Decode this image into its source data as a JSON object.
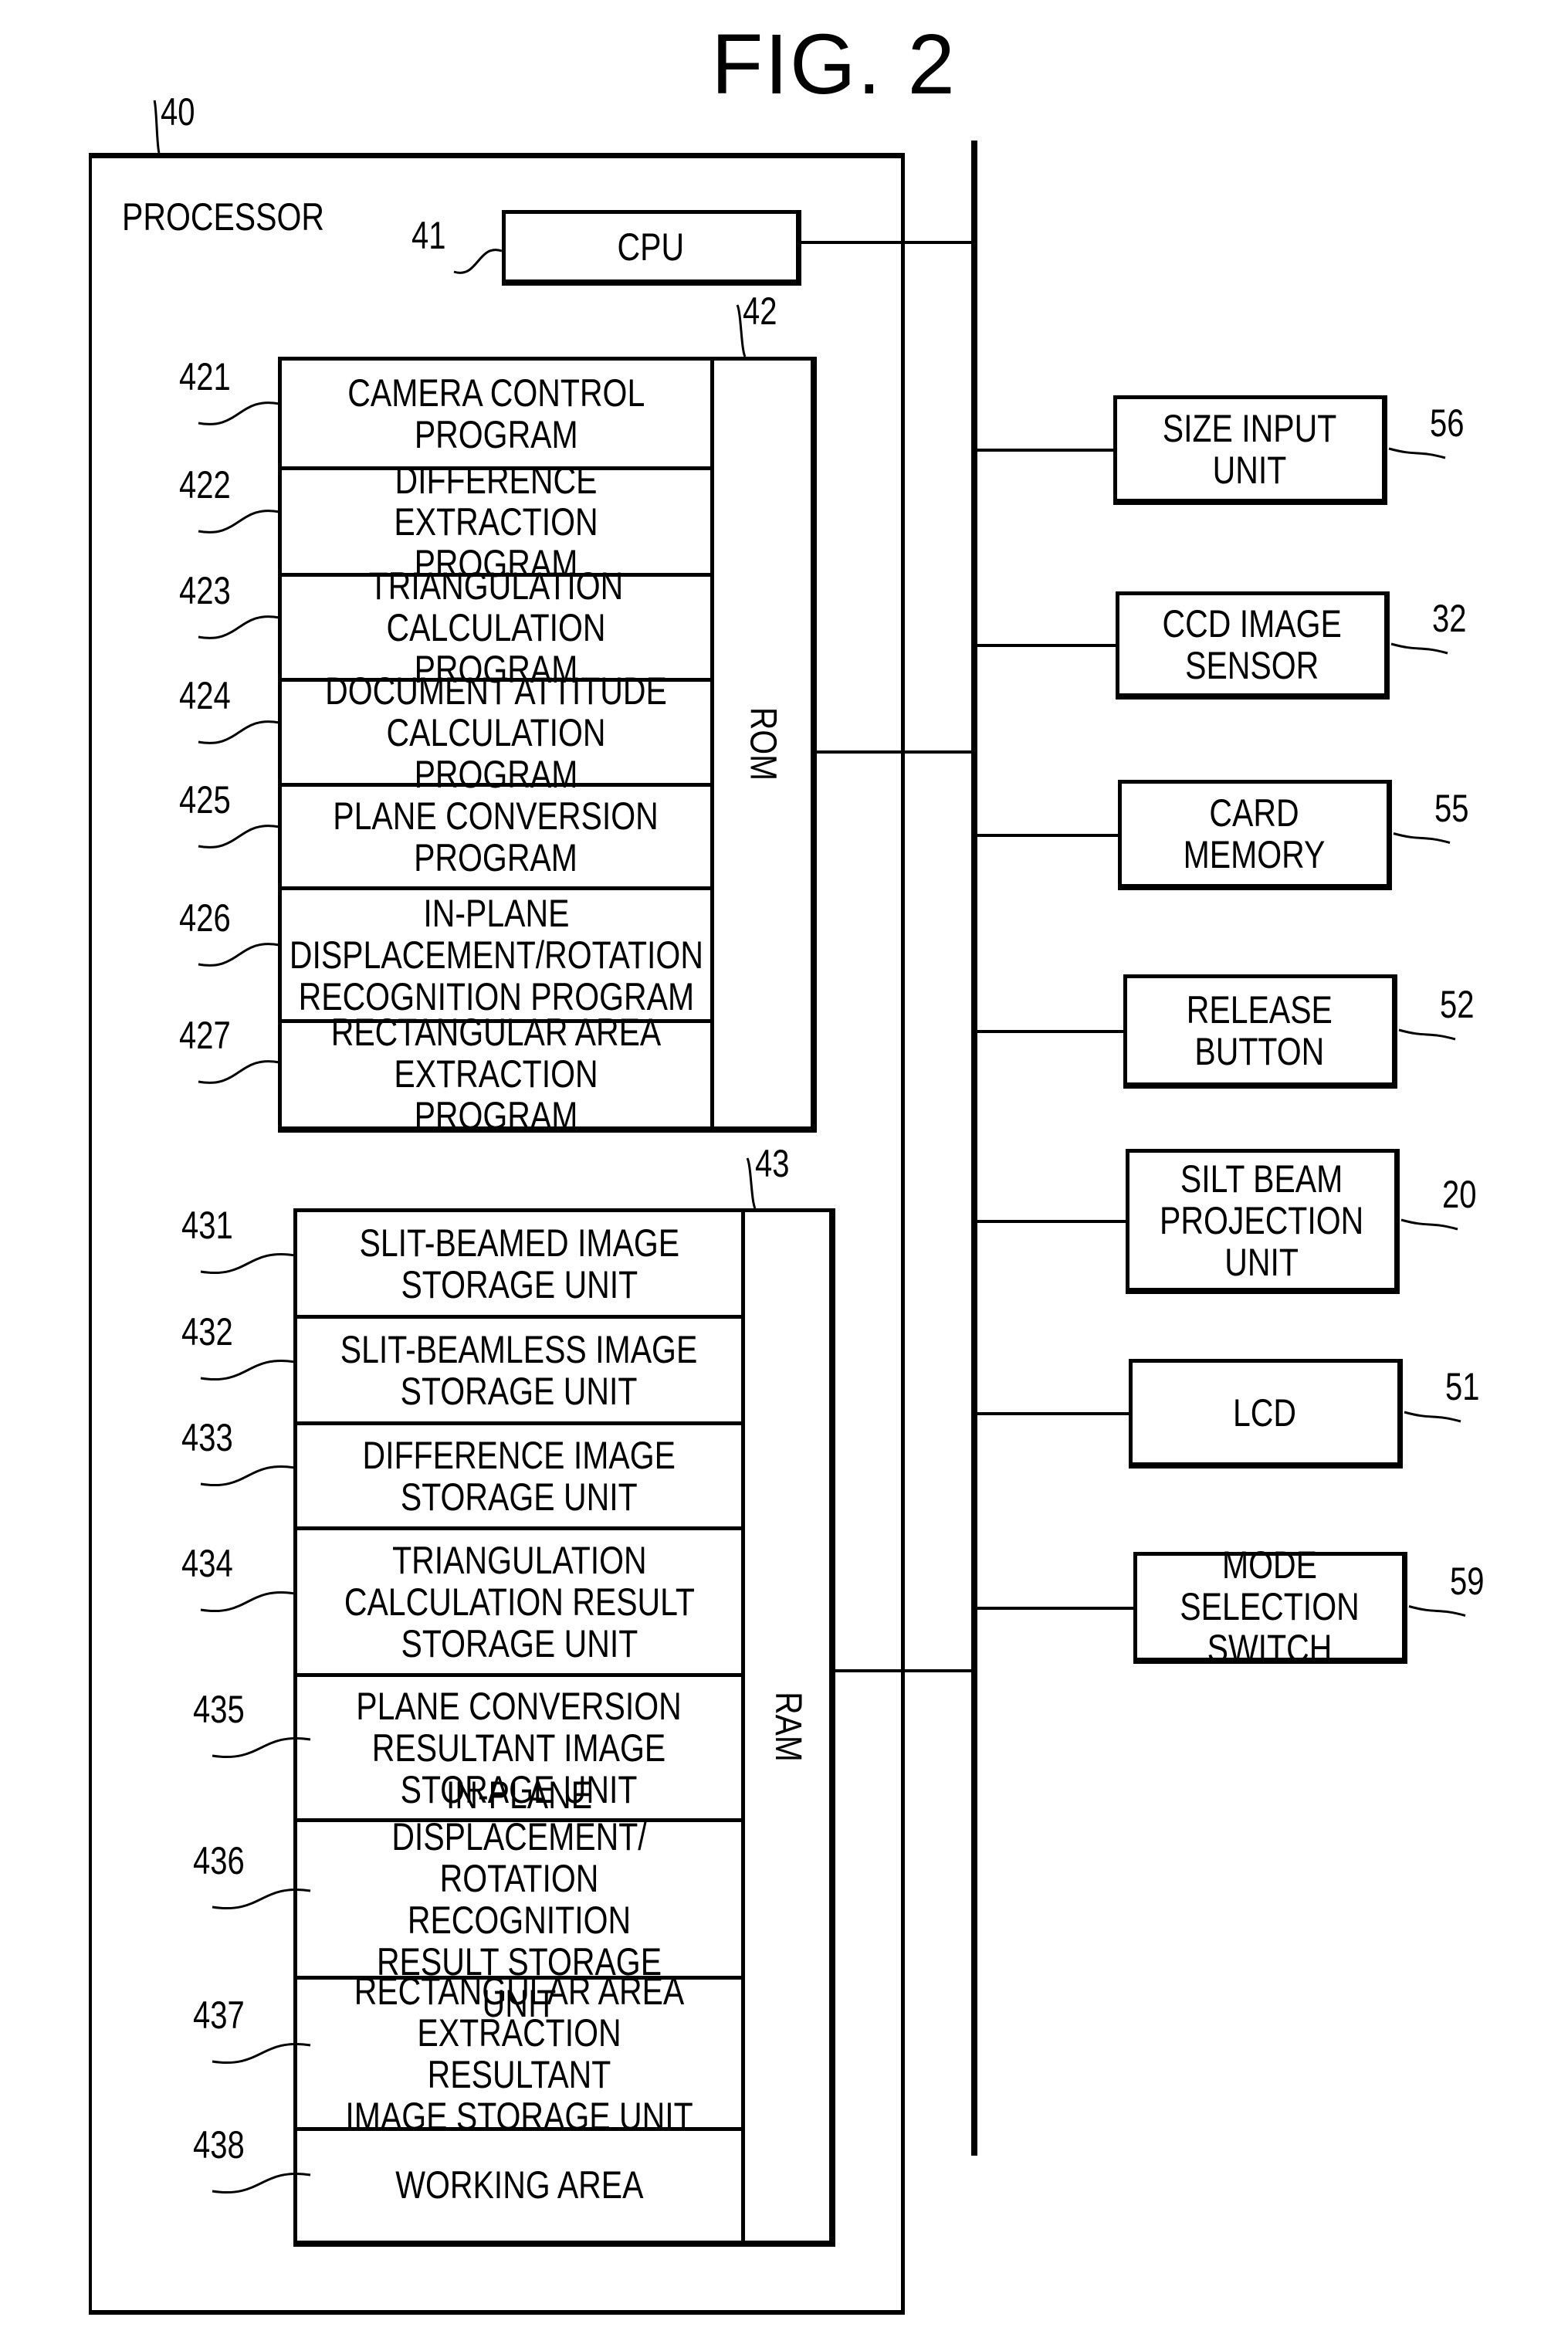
{
  "figure": {
    "title": "FIG. 2"
  },
  "processor": {
    "ref": "40",
    "label": "PROCESSOR",
    "cpu": {
      "ref": "41",
      "label": "CPU"
    },
    "rom": {
      "ref": "42",
      "label": "ROM",
      "items": [
        {
          "ref": "421",
          "label": "CAMERA CONTROL\nPROGRAM"
        },
        {
          "ref": "422",
          "label": "DIFFERENCE EXTRACTION\nPROGRAM"
        },
        {
          "ref": "423",
          "label": "TRIANGULATION\nCALCULATION PROGRAM"
        },
        {
          "ref": "424",
          "label": "DOCUMENT ATTITUDE\nCALCULATION PROGRAM"
        },
        {
          "ref": "425",
          "label": "PLANE CONVERSION\nPROGRAM"
        },
        {
          "ref": "426",
          "label": "IN-PLANE\nDISPLACEMENT/ROTATION\nRECOGNITION PROGRAM"
        },
        {
          "ref": "427",
          "label": "RECTANGULAR AREA\nEXTRACTION PROGRAM"
        }
      ]
    },
    "ram": {
      "ref": "43",
      "label": "RAM",
      "items": [
        {
          "ref": "431",
          "label": "SLIT-BEAMED IMAGE\nSTORAGE UNIT"
        },
        {
          "ref": "432",
          "label": "SLIT-BEAMLESS IMAGE\nSTORAGE UNIT"
        },
        {
          "ref": "433",
          "label": "DIFFERENCE IMAGE\nSTORAGE UNIT"
        },
        {
          "ref": "434",
          "label": "TRIANGULATION\nCALCULATION RESULT\nSTORAGE UNIT"
        },
        {
          "ref": "435",
          "label": "PLANE CONVERSION\nRESULTANT IMAGE\nSTORAGE UNIT"
        },
        {
          "ref": "436",
          "label": "IN-PLANE DISPLACEMENT/\nROTATION RECOGNITION\nRESULT STORAGE UNIT"
        },
        {
          "ref": "437",
          "label": "RECTANGULAR AREA\nEXTRACTION RESULTANT\nIMAGE STORAGE UNIT"
        },
        {
          "ref": "438",
          "label": "WORKING AREA"
        }
      ]
    }
  },
  "peripherals": [
    {
      "ref": "56",
      "label": "SIZE INPUT UNIT"
    },
    {
      "ref": "32",
      "label": "CCD IMAGE\nSENSOR"
    },
    {
      "ref": "55",
      "label": "CARD MEMORY"
    },
    {
      "ref": "52",
      "label": "RELEASE\nBUTTON"
    },
    {
      "ref": "20",
      "label": "SILT BEAM\nPROJECTION\nUNIT"
    },
    {
      "ref": "51",
      "label": "LCD"
    },
    {
      "ref": "59",
      "label": "MODE SELECTION\nSWITCH"
    }
  ]
}
